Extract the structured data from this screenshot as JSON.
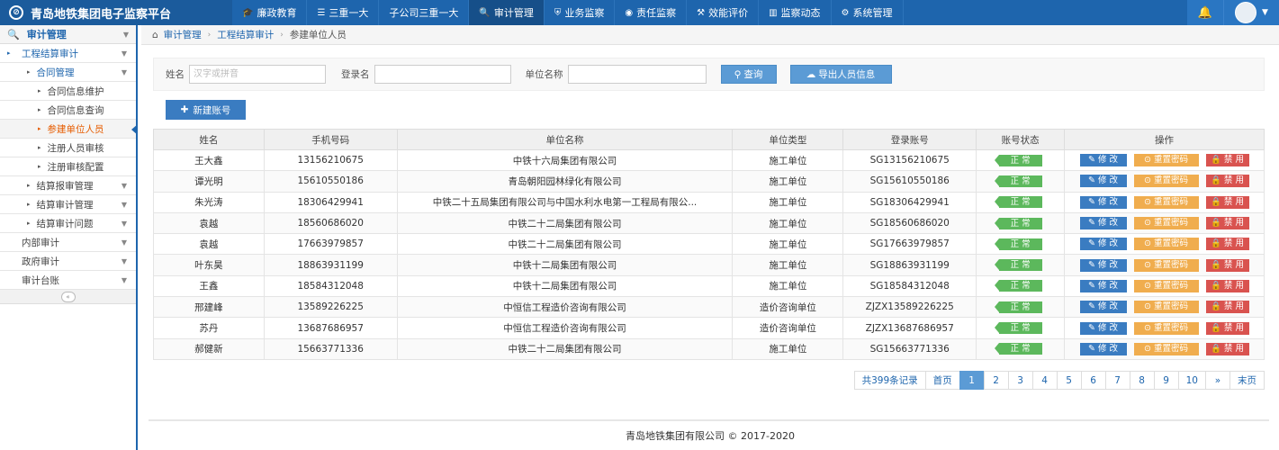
{
  "app": {
    "title": "青岛地铁集团电子监察平台"
  },
  "nav": [
    {
      "icon": "graduation-cap-icon",
      "glyph": "🎓",
      "label": "廉政教育"
    },
    {
      "icon": "list-icon",
      "glyph": "☰",
      "label": "三重一大"
    },
    {
      "icon": "",
      "glyph": "",
      "label": "子公司三重一大"
    },
    {
      "icon": "search-icon",
      "glyph": "🔍",
      "label": "审计管理"
    },
    {
      "icon": "shield-icon",
      "glyph": "⛨",
      "label": "业务监察"
    },
    {
      "icon": "eye-icon",
      "glyph": "◉",
      "label": "责任监察"
    },
    {
      "icon": "gavel-icon",
      "glyph": "⚒",
      "label": "效能评价"
    },
    {
      "icon": "bar-chart-icon",
      "glyph": "▥",
      "label": "监察动态"
    },
    {
      "icon": "gears-icon",
      "glyph": "⚙",
      "label": "系统管理"
    }
  ],
  "sidebar": {
    "header": "审计管理",
    "items": [
      {
        "label": "工程结算审计",
        "level": "l1"
      },
      {
        "label": "合同管理",
        "level": "l2"
      },
      {
        "label": "合同信息维护",
        "level": "l3"
      },
      {
        "label": "合同信息查询",
        "level": "l3"
      },
      {
        "label": "参建单位人员",
        "level": "l3",
        "current": true
      },
      {
        "label": "注册人员审核",
        "level": "l3"
      },
      {
        "label": "注册审核配置",
        "level": "l3"
      },
      {
        "label": "结算报审管理",
        "level": "l2b"
      },
      {
        "label": "结算审计管理",
        "level": "l2b"
      },
      {
        "label": "结算审计问题",
        "level": "l2b"
      },
      {
        "label": "内部审计",
        "level": "top"
      },
      {
        "label": "政府审计",
        "level": "top"
      },
      {
        "label": "审计台账",
        "level": "top"
      }
    ]
  },
  "breadcrumb": [
    "审计管理",
    "工程结算审计",
    "参建单位人员"
  ],
  "filter": {
    "name_label": "姓名",
    "name_placeholder": "汉字或拼音",
    "login_label": "登录名",
    "unit_label": "单位名称",
    "query_label": "查询",
    "export_label": "导出人员信息"
  },
  "new_button": "新建账号",
  "table": {
    "headers": [
      "姓名",
      "手机号码",
      "单位名称",
      "单位类型",
      "登录账号",
      "账号状态",
      "操作"
    ],
    "rows": [
      [
        "王大鑫",
        "13156210675",
        "中铁十六局集团有限公司",
        "施工单位",
        "SG13156210675",
        "正 常"
      ],
      [
        "谭光明",
        "15610550186",
        "青岛朝阳园林绿化有限公司",
        "施工单位",
        "SG15610550186",
        "正 常"
      ],
      [
        "朱光涛",
        "18306429941",
        "中铁二十五局集团有限公司与中国水利水电第一工程局有限公...",
        "施工单位",
        "SG18306429941",
        "正 常"
      ],
      [
        "袁越",
        "18560686020",
        "中铁二十二局集团有限公司",
        "施工单位",
        "SG18560686020",
        "正 常"
      ],
      [
        "袁越",
        "17663979857",
        "中铁二十二局集团有限公司",
        "施工单位",
        "SG17663979857",
        "正 常"
      ],
      [
        "叶东昊",
        "18863931199",
        "中铁十二局集团有限公司",
        "施工单位",
        "SG18863931199",
        "正 常"
      ],
      [
        "王鑫",
        "18584312048",
        "中铁十二局集团有限公司",
        "施工单位",
        "SG18584312048",
        "正 常"
      ],
      [
        "邢建峰",
        "13589226225",
        "中恒信工程造价咨询有限公司",
        "造价咨询单位",
        "ZJZX13589226225",
        "正 常"
      ],
      [
        "苏丹",
        "13687686957",
        "中恒信工程造价咨询有限公司",
        "造价咨询单位",
        "ZJZX13687686957",
        "正 常"
      ],
      [
        "郝健新",
        "15663771336",
        "中铁二十二局集团有限公司",
        "施工单位",
        "SG15663771336",
        "正 常"
      ]
    ],
    "actions": {
      "edit": "修 改",
      "reset": "重置密码",
      "ban": "禁 用"
    }
  },
  "pagination": {
    "total": "共399条记录",
    "first": "首页",
    "pages": [
      "1",
      "2",
      "3",
      "4",
      "5",
      "6",
      "7",
      "8",
      "9",
      "10"
    ],
    "current": "1",
    "next": "»",
    "last": "末页"
  },
  "footer": "青岛地铁集团有限公司 © 2017-2020"
}
